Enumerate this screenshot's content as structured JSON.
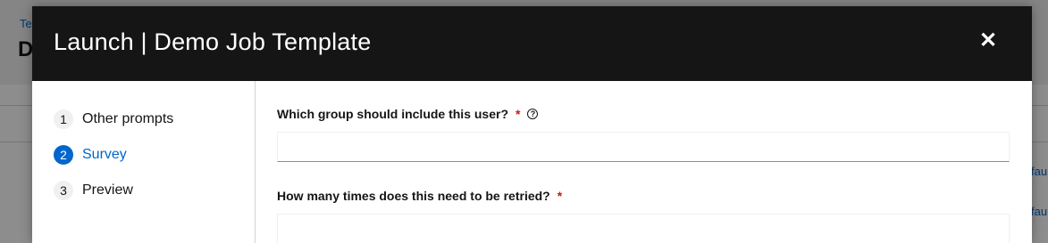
{
  "background": {
    "breadcrumb": "Te",
    "title": "D",
    "right_link_1": "fau",
    "right_link_2": "fau"
  },
  "modal": {
    "title": "Launch | Demo Job Template",
    "close_label": "✕"
  },
  "wizard": {
    "steps": [
      {
        "number": "1",
        "label": "Other prompts",
        "current": false
      },
      {
        "number": "2",
        "label": "Survey",
        "current": true
      },
      {
        "number": "3",
        "label": "Preview",
        "current": false
      }
    ]
  },
  "survey": {
    "questions": [
      {
        "label": "Which group should include this user?",
        "required_mark": "*",
        "help_icon": "?",
        "value": "",
        "placeholder": ""
      },
      {
        "label": "How many times does this need to be retried?",
        "required_mark": "*",
        "value": "",
        "placeholder": ""
      }
    ]
  },
  "colors": {
    "header": "#151515",
    "accent": "#0066cc",
    "required": "#c9190b"
  }
}
